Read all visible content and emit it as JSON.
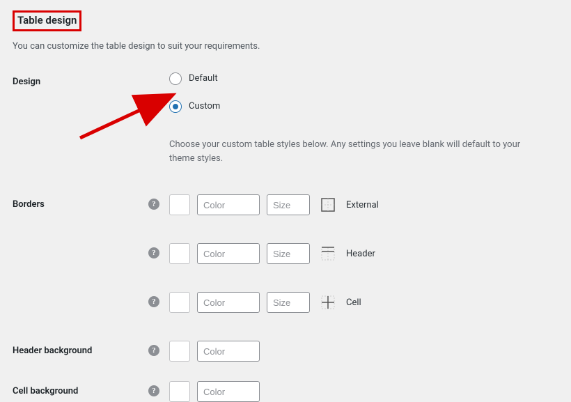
{
  "title": "Table design",
  "description": "You can customize the table design to suit your requirements.",
  "design": {
    "label": "Design",
    "options": {
      "default": "Default",
      "custom": "Custom"
    },
    "selected": "custom",
    "helper": "Choose your custom table styles below. Any settings you leave blank will default to your theme styles."
  },
  "borders": {
    "label": "Borders",
    "color_placeholder": "Color",
    "size_placeholder": "Size",
    "rows": {
      "external": "External",
      "header": "Header",
      "cell": "Cell"
    }
  },
  "header_bg": {
    "label": "Header background",
    "color_placeholder": "Color"
  },
  "cell_bg": {
    "label": "Cell background",
    "color_placeholder": "Color"
  }
}
